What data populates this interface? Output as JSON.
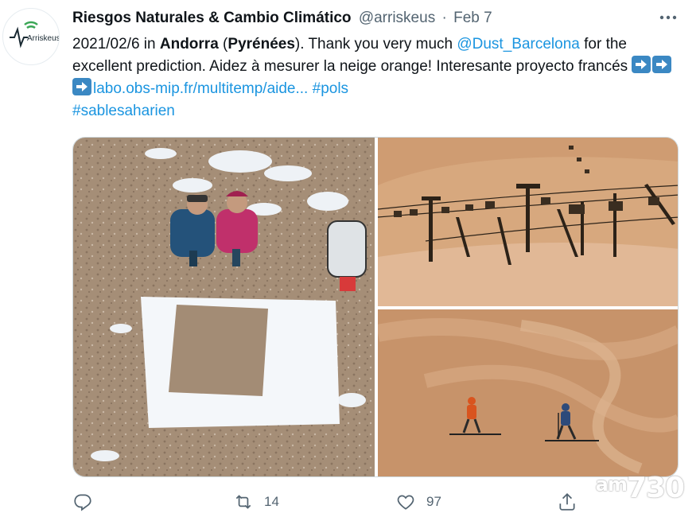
{
  "tweet": {
    "author_name": "Riesgos Naturales & Cambio Climático",
    "handle": "@arriskeus",
    "separator": "·",
    "date": "Feb 7",
    "avatar_logo_text": "Arriskeus",
    "text_parts": {
      "p1": "2021/02/6 in ",
      "p2": "Andorra",
      "p3": " (",
      "p4": "Pyrénées",
      "p5": "). Thank you very much ",
      "mention": "@Dust_Barcelona",
      "p6": " for the excellent prediction.  Aidez à mesurer la neige orange! Interesante proyecto francés ",
      "url": "labo.obs-mip.fr/multitemp/aide...",
      "p7": " ",
      "hashtag1": "#pols",
      "hashtag2": "#sablesaharien"
    },
    "actions": {
      "reply_icon": "reply-icon",
      "retweet_icon": "retweet-icon",
      "retweet_count": "14",
      "like_icon": "heart-icon",
      "like_count": "97",
      "share_icon": "share-icon"
    }
  },
  "watermark": {
    "prefix": "am",
    "number": "730"
  },
  "colors": {
    "link": "#1b95e0",
    "muted": "#536471",
    "arrow_emoji": "#3b88c3"
  }
}
